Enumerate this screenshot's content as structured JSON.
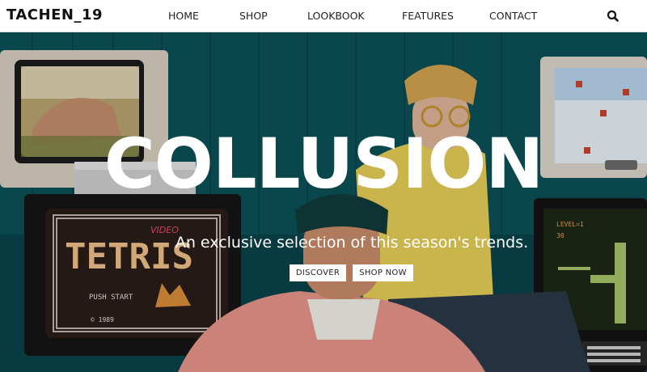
{
  "header": {
    "brand": "TACHEN_19",
    "nav": [
      {
        "label": "HOME"
      },
      {
        "label": "SHOP"
      },
      {
        "label": "LOOKBOOK"
      },
      {
        "label": "FEATURES"
      },
      {
        "label": "CONTACT"
      }
    ],
    "search_icon": "search-icon"
  },
  "hero": {
    "title": "COLLUSION",
    "subtitle": "An exclusive selection of this season's trends.",
    "buttons": [
      {
        "label": "DISCOVER"
      },
      {
        "label": "SHOP NOW"
      }
    ],
    "image_text": {
      "game_title": "TETRIS",
      "game_badge": "VIDEO",
      "push_start": "PUSH START",
      "copyright": "© 1989",
      "level_label": "LEVEL=1",
      "level_value": "30"
    }
  }
}
